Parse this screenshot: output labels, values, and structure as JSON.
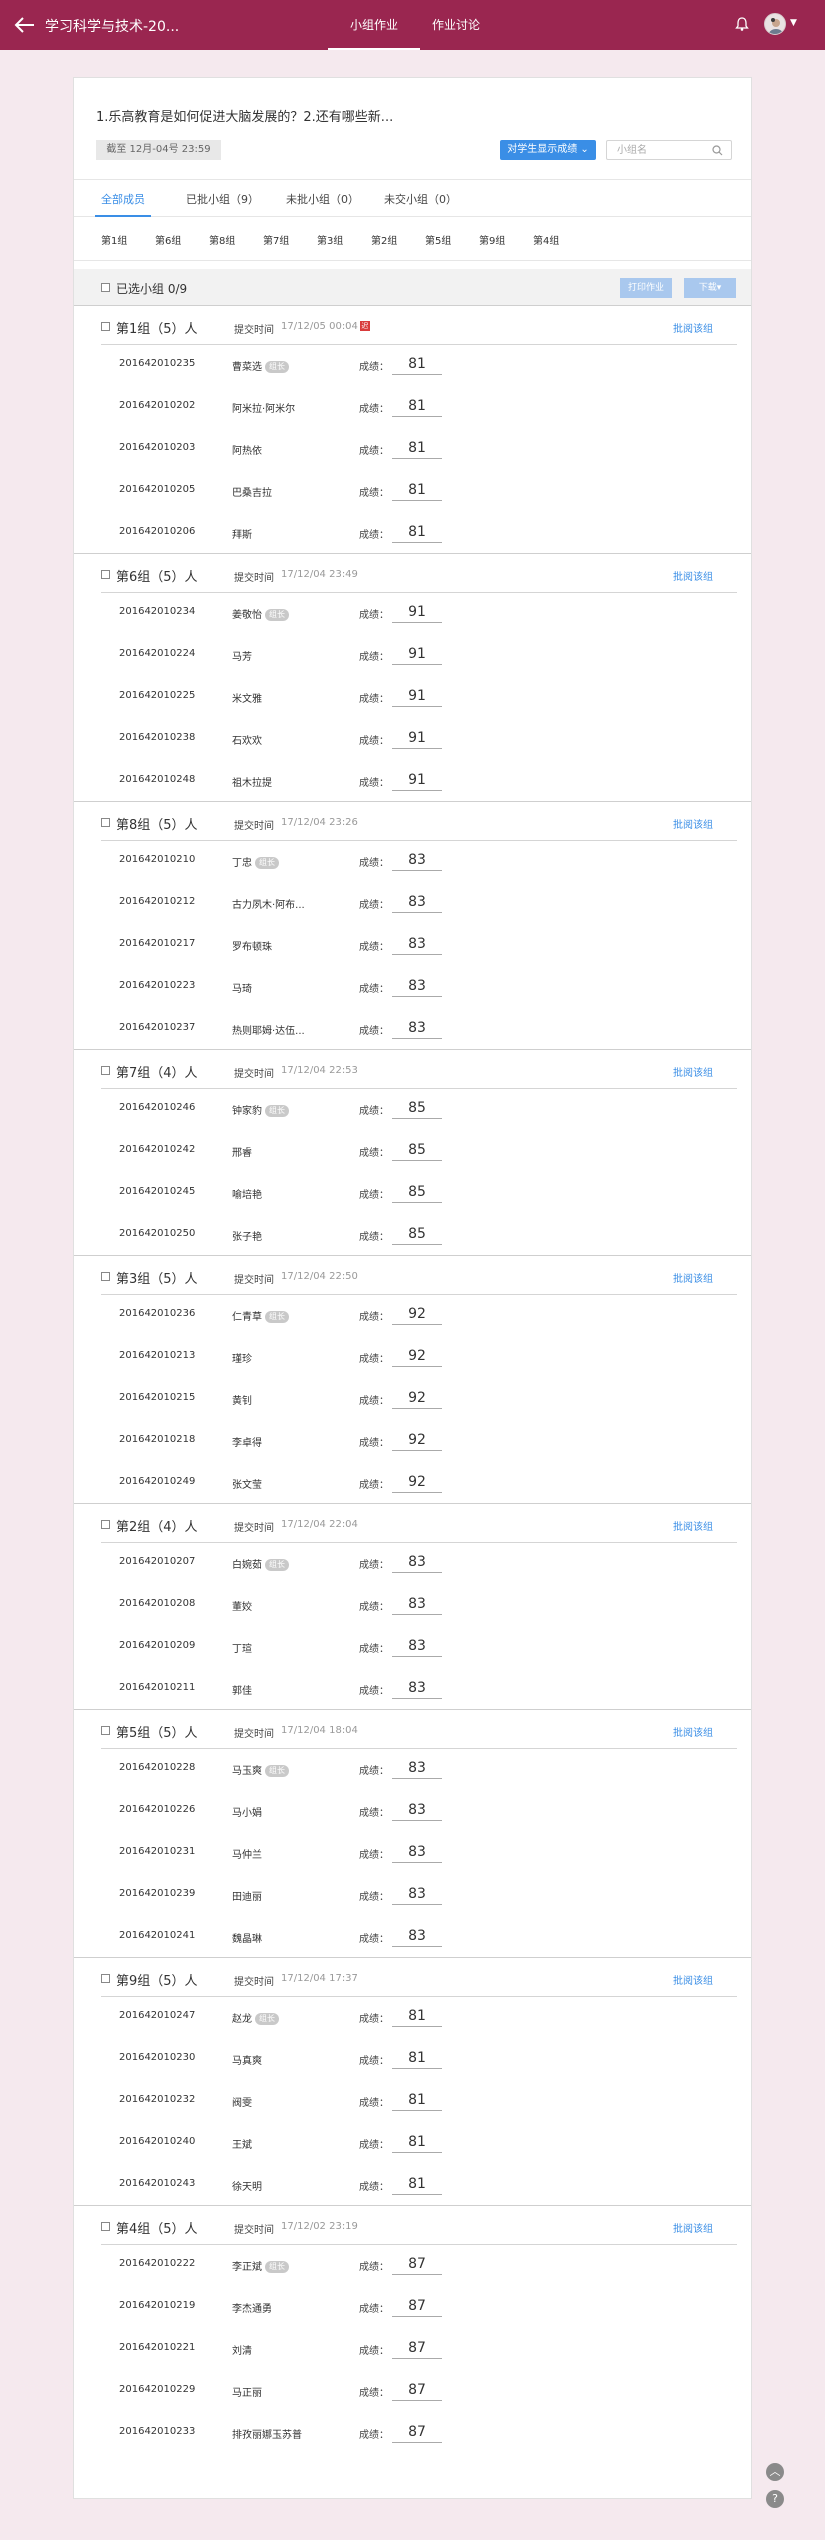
{
  "header": {
    "title": "学习科学与技术-20...",
    "tabs": [
      "小组作业",
      "作业讨论"
    ],
    "active_tab": 0
  },
  "assignment": {
    "question": "1.乐高教育是如何促进大脑发展的？2.还有哪些新...",
    "deadline": "截至 12月-04号 23:59",
    "show_button": "对学生显示成绩",
    "search_placeholder": "小组名"
  },
  "filters": {
    "tabs": [
      "全部成员",
      "已批小组（9）",
      "未批小组（0）",
      "未交小组（0）"
    ],
    "active_tab": 0,
    "groups": [
      "第1组",
      "第6组",
      "第8组",
      "第7组",
      "第3组",
      "第2组",
      "第5组",
      "第9组",
      "第4组"
    ]
  },
  "selection": {
    "label": "已选小组 0/9",
    "print": "打印作业",
    "download": "下载▾"
  },
  "labels": {
    "submit_time": "提交时间",
    "score": "成绩：",
    "review": "批阅该组",
    "leader": "组长",
    "late": "迟"
  },
  "groups": [
    {
      "name": "第1组（5）人",
      "time": "17/12/05 00:04",
      "late": true,
      "members": [
        {
          "id": "201642010235",
          "name": "曹菜选",
          "leader": true,
          "score": "81"
        },
        {
          "id": "201642010202",
          "name": "阿米拉·阿米尔",
          "leader": false,
          "score": "81"
        },
        {
          "id": "201642010203",
          "name": "阿热依",
          "leader": false,
          "score": "81"
        },
        {
          "id": "201642010205",
          "name": "巴桑吉拉",
          "leader": false,
          "score": "81"
        },
        {
          "id": "201642010206",
          "name": "拜斯",
          "leader": false,
          "score": "81"
        }
      ]
    },
    {
      "name": "第6组（5）人",
      "time": "17/12/04 23:49",
      "late": false,
      "members": [
        {
          "id": "201642010234",
          "name": "姜敬怡",
          "leader": true,
          "score": "91"
        },
        {
          "id": "201642010224",
          "name": "马芳",
          "leader": false,
          "score": "91"
        },
        {
          "id": "201642010225",
          "name": "米文雅",
          "leader": false,
          "score": "91"
        },
        {
          "id": "201642010238",
          "name": "石欢欢",
          "leader": false,
          "score": "91"
        },
        {
          "id": "201642010248",
          "name": "祖木拉提",
          "leader": false,
          "score": "91"
        }
      ]
    },
    {
      "name": "第8组（5）人",
      "time": "17/12/04 23:26",
      "late": false,
      "members": [
        {
          "id": "201642010210",
          "name": "丁忠",
          "leader": true,
          "score": "83"
        },
        {
          "id": "201642010212",
          "name": "古力夙木·阿布...",
          "leader": false,
          "score": "83"
        },
        {
          "id": "201642010217",
          "name": "罗布顿珠",
          "leader": false,
          "score": "83"
        },
        {
          "id": "201642010223",
          "name": "马琦",
          "leader": false,
          "score": "83"
        },
        {
          "id": "201642010237",
          "name": "热则耶姆·达伍...",
          "leader": false,
          "score": "83"
        }
      ]
    },
    {
      "name": "第7组（4）人",
      "time": "17/12/04 22:53",
      "late": false,
      "members": [
        {
          "id": "201642010246",
          "name": "钟家豹",
          "leader": true,
          "score": "85"
        },
        {
          "id": "201642010242",
          "name": "邢睿",
          "leader": false,
          "score": "85"
        },
        {
          "id": "201642010245",
          "name": "喻培艳",
          "leader": false,
          "score": "85"
        },
        {
          "id": "201642010250",
          "name": "张子艳",
          "leader": false,
          "score": "85"
        }
      ]
    },
    {
      "name": "第3组（5）人",
      "time": "17/12/04 22:50",
      "late": false,
      "members": [
        {
          "id": "201642010236",
          "name": "仁青草",
          "leader": true,
          "score": "92"
        },
        {
          "id": "201642010213",
          "name": "瑾珍",
          "leader": false,
          "score": "92"
        },
        {
          "id": "201642010215",
          "name": "黄钊",
          "leader": false,
          "score": "92"
        },
        {
          "id": "201642010218",
          "name": "李卓得",
          "leader": false,
          "score": "92"
        },
        {
          "id": "201642010249",
          "name": "张文莹",
          "leader": false,
          "score": "92"
        }
      ]
    },
    {
      "name": "第2组（4）人",
      "time": "17/12/04 22:04",
      "late": false,
      "members": [
        {
          "id": "201642010207",
          "name": "白婉茹",
          "leader": true,
          "score": "83"
        },
        {
          "id": "201642010208",
          "name": "董姣",
          "leader": false,
          "score": "83"
        },
        {
          "id": "201642010209",
          "name": "丁瑄",
          "leader": false,
          "score": "83"
        },
        {
          "id": "201642010211",
          "name": "郭佳",
          "leader": false,
          "score": "83"
        }
      ]
    },
    {
      "name": "第5组（5）人",
      "time": "17/12/04 18:04",
      "late": false,
      "members": [
        {
          "id": "201642010228",
          "name": "马玉爽",
          "leader": true,
          "score": "83"
        },
        {
          "id": "201642010226",
          "name": "马小娟",
          "leader": false,
          "score": "83"
        },
        {
          "id": "201642010231",
          "name": "马仲兰",
          "leader": false,
          "score": "83"
        },
        {
          "id": "201642010239",
          "name": "田迪丽",
          "leader": false,
          "score": "83"
        },
        {
          "id": "201642010241",
          "name": "魏晶琳",
          "leader": false,
          "score": "83"
        }
      ]
    },
    {
      "name": "第9组（5）人",
      "time": "17/12/04 17:37",
      "late": false,
      "members": [
        {
          "id": "201642010247",
          "name": "赵龙",
          "leader": true,
          "score": "81"
        },
        {
          "id": "201642010230",
          "name": "马真爽",
          "leader": false,
          "score": "81"
        },
        {
          "id": "201642010232",
          "name": "阀雯",
          "leader": false,
          "score": "81"
        },
        {
          "id": "201642010240",
          "name": "王斌",
          "leader": false,
          "score": "81"
        },
        {
          "id": "201642010243",
          "name": "徐天明",
          "leader": false,
          "score": "81"
        }
      ]
    },
    {
      "name": "第4组（5）人",
      "time": "17/12/02 23:19",
      "late": false,
      "members": [
        {
          "id": "201642010222",
          "name": "李正斌",
          "leader": true,
          "score": "87"
        },
        {
          "id": "201642010219",
          "name": "李杰通勇",
          "leader": false,
          "score": "87"
        },
        {
          "id": "201642010221",
          "name": "刘清",
          "leader": false,
          "score": "87"
        },
        {
          "id": "201642010229",
          "name": "马正丽",
          "leader": false,
          "score": "87"
        },
        {
          "id": "201642010233",
          "name": "排孜丽娜玉苏普",
          "leader": false,
          "score": "87"
        }
      ]
    }
  ],
  "fab": {
    "top": "︿",
    "help": "?"
  },
  "colors": {
    "header": "#9a2650",
    "accent": "#3a8ee6",
    "background": "#f5e9ee"
  }
}
